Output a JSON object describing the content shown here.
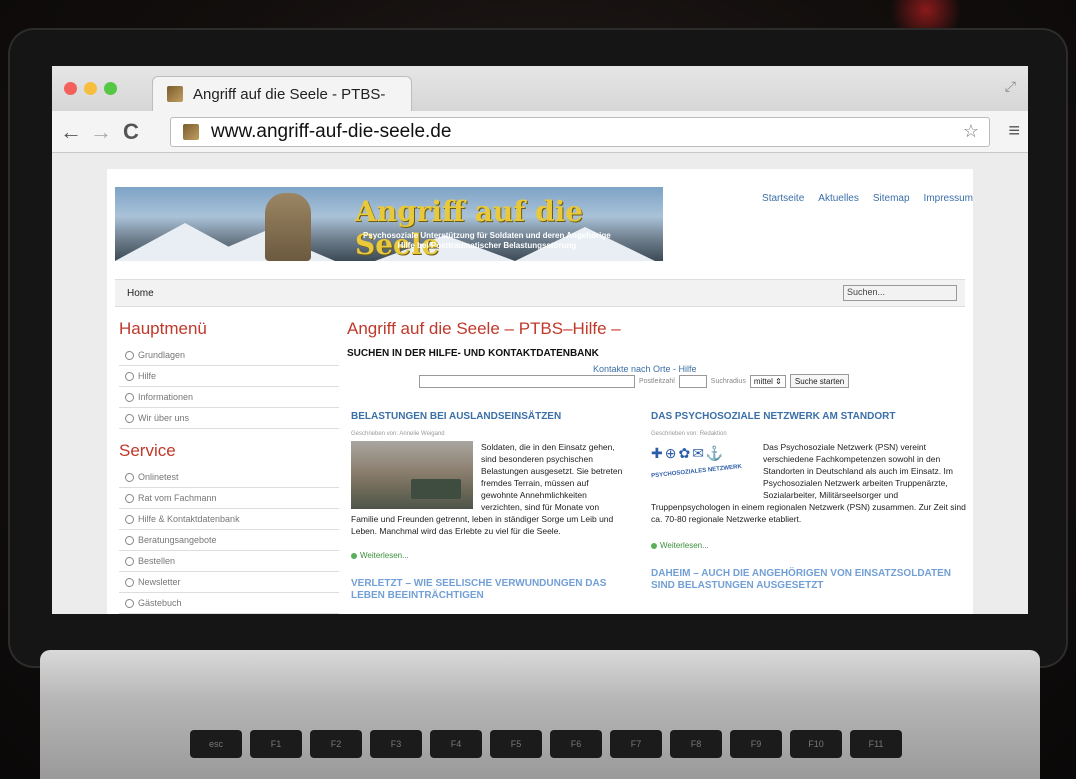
{
  "browser": {
    "tab_title": "Angriff auf die Seele - PTBS-",
    "url": "www.angriff-auf-die-seele.de",
    "back_icon": "←",
    "forward_icon": "→",
    "reload_icon": "C",
    "star_icon": "☆",
    "menu_icon": "≡",
    "expand_icon": "⤢",
    "colors": {
      "close": "#f4605b",
      "minimize": "#f7bd3d",
      "zoom": "#56c744"
    }
  },
  "banner": {
    "title": "Angriff auf die Seele",
    "subtitle_line1": "Psychosoziale Unterstützung für Soldaten und deren Angehörige",
    "subtitle_line2": "Hilfe bei Posttraumatischer Belastungsstörung"
  },
  "topnav": [
    "Startseite",
    "Aktuelles",
    "Sitemap",
    "Impressum"
  ],
  "homebar": {
    "home": "Home",
    "search_placeholder": "Suchen..."
  },
  "sidebar": {
    "hauptmenu_title": "Hauptmenü",
    "hauptmenu": [
      "Grundlagen",
      "Hilfe",
      "Informationen",
      "Wir über uns"
    ],
    "service_title": "Service",
    "service": [
      "Onlinetest",
      "Rat vom Fachmann",
      "Hilfe & Kontaktdatenbank",
      "Beratungsangebote",
      "Bestellen",
      "Newsletter",
      "Gästebuch"
    ]
  },
  "main": {
    "title": "Angriff auf die Seele – PTBS–Hilfe –",
    "subtitle": "SUCHEN IN DER HILFE- UND KONTAKTDATENBANK",
    "kontakt_link": "Kontakte nach Orte - Hilfe",
    "postleitzahl_label": "Postleitzahl",
    "suchradius_label": "Suchradius",
    "select_value": "mittel",
    "search_button": "Suche starten"
  },
  "articles": {
    "a1": {
      "title": "BELASTUNGEN BEI AUSLANDSEINSÄTZEN",
      "meta": "Geschrieben von: Annelie Weigand",
      "body": "Soldaten, die in den Einsatz gehen, sind besonderen psychischen Belastungen ausgesetzt. Sie betreten fremdes Terrain, müssen auf gewohnte Annehmlichkeiten verzichten, sind für Monate von Familie und Freunden getrennt, leben in ständiger Sorge um Leib und Leben. Manchmal wird das Erlebte zu viel für die Seele.",
      "more": "Weiterlesen..."
    },
    "a2": {
      "title": "DAS PSYCHOSOZIALE NETZWERK AM STANDORT",
      "meta": "Geschrieben von: Redaktion",
      "logo_text": "PSYCHOSOZIALES NETZWERK",
      "body": "Das Psychosoziale Netzwerk (PSN) vereint verschiedene Fachkompetenzen sowohl in den Standorten in Deutschland als auch im Einsatz. Im Psychosozialen Netzwerk arbeiten Truppenärzte, Sozialarbeiter, Militärseelsorger und Truppenpsychologen in einem regionalen Netzwerk (PSN) zusammen. Zur Zeit sind ca. 70-80 regionale Netzwerke etabliert.",
      "more": "Weiterlesen..."
    },
    "a3": {
      "title": "VERLETZT – WIE SEELISCHE VERWUNDUNGEN DAS LEBEN BEEINTRÄCHTIGEN"
    },
    "a4": {
      "title": "DAHEIM – AUCH DIE ANGEHÖRIGEN VON EINSATZSOLDATEN SIND BELASTUNGEN AUSGESETZT"
    }
  },
  "keyboard": [
    "esc",
    "F1",
    "F2",
    "F3",
    "F4",
    "F5",
    "F6",
    "F7",
    "F8",
    "F9",
    "F10",
    "F11"
  ]
}
